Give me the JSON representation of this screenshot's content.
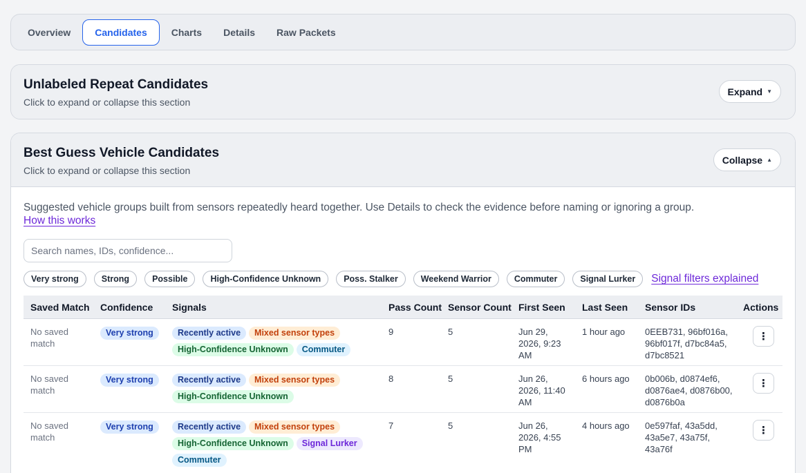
{
  "tabs": [
    {
      "label": "Overview",
      "active": false
    },
    {
      "label": "Candidates",
      "active": true
    },
    {
      "label": "Charts",
      "active": false
    },
    {
      "label": "Details",
      "active": false
    },
    {
      "label": "Raw Packets",
      "active": false
    }
  ],
  "section1": {
    "title": "Unlabeled Repeat Candidates",
    "subtitle": "Click to expand or collapse this section",
    "button": "Expand"
  },
  "section2": {
    "title": "Best Guess Vehicle Candidates",
    "subtitle": "Click to expand or collapse this section",
    "button": "Collapse",
    "description": "Suggested vehicle groups built from sensors repeatedly heard together. Use Details to check the evidence before naming or ignoring a group.",
    "how_link": "How this works",
    "search_placeholder": "Search names, IDs, confidence...",
    "filters": [
      "Very strong",
      "Strong",
      "Possible",
      "High-Confidence Unknown",
      "Poss. Stalker",
      "Weekend Warrior",
      "Commuter",
      "Signal Lurker"
    ],
    "filters_link": "Signal filters explained"
  },
  "table": {
    "headers": {
      "saved": "Saved Match",
      "confidence": "Confidence",
      "signals": "Signals",
      "pass_count": "Pass Count",
      "sensor_count": "Sensor Count",
      "first_seen": "First Seen",
      "last_seen": "Last Seen",
      "sensor_ids": "Sensor IDs",
      "actions": "Actions"
    },
    "rows": [
      {
        "saved": "No saved match",
        "confidence": "Very strong",
        "signals": [
          [
            "Recently active",
            "blue"
          ],
          [
            "Mixed sensor types",
            "orange"
          ],
          [
            "High-Confidence Unknown",
            "green"
          ],
          [
            "Commuter",
            "lightblue"
          ]
        ],
        "pass_count": "9",
        "sensor_count": "5",
        "first_seen": "Jun 29, 2026, 9:23 AM",
        "last_seen": "1 hour ago",
        "sensor_ids": "0EEB731, 96bf016a, 96bf017f, d7bc84a5, d7bc8521",
        "actions": "⋮"
      },
      {
        "saved": "No saved match",
        "confidence": "Very strong",
        "signals": [
          [
            "Recently active",
            "blue"
          ],
          [
            "Mixed sensor types",
            "orange"
          ],
          [
            "High-Confidence Unknown",
            "green"
          ]
        ],
        "pass_count": "8",
        "sensor_count": "5",
        "first_seen": "Jun 26, 2026, 11:40 AM",
        "last_seen": "6 hours ago",
        "sensor_ids": "0b006b, d0874ef6, d0876ae4, d0876b00, d0876b0a",
        "actions": "⋮"
      },
      {
        "saved": "No saved match",
        "confidence": "Very strong",
        "signals": [
          [
            "Recently active",
            "blue"
          ],
          [
            "Mixed sensor types",
            "orange"
          ],
          [
            "High-Confidence Unknown",
            "green"
          ],
          [
            "Signal Lurker",
            "purple"
          ],
          [
            "Commuter",
            "lightblue"
          ]
        ],
        "pass_count": "7",
        "sensor_count": "5",
        "first_seen": "Jun 26, 2026, 4:55 PM",
        "last_seen": "4 hours ago",
        "sensor_ids": "0e597faf, 43a5dd, 43a5e7, 43a75f, 43a76f",
        "actions": "⋮"
      }
    ]
  }
}
